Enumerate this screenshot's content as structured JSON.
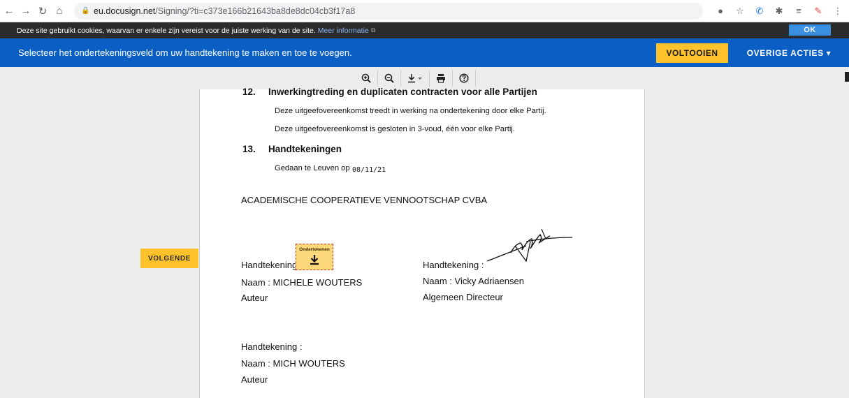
{
  "browser": {
    "url_domain": "eu.docusign.net",
    "url_path": "/Signing/?ti=c373e166b21643ba8de8dc04cb3f17a8"
  },
  "cookie_bar": {
    "text": "Deze site gebruikt cookies, waarvan er enkele zijn vereist voor de juiste werking van de site.",
    "link": "Meer informatie",
    "ok_label": "OK"
  },
  "action_bar": {
    "message": "Selecteer het ondertekeningsveld om uw handtekening te maken en toe te voegen.",
    "finish_label": "VOLTOOIEN",
    "other_label": "OVERIGE ACTIES ▾"
  },
  "toolbar": {
    "tools": [
      "zoom-in",
      "zoom-out",
      "download",
      "print",
      "help"
    ]
  },
  "navigation": {
    "next_label": "VOLGENDE"
  },
  "document": {
    "section12": {
      "number": "12.",
      "title": "Inwerkingtreding en duplicaten contracten voor alle Partijen",
      "para1": "Deze uitgeefovereenkomst treedt in werking na ondertekening door elke Partij.",
      "para2": "Deze uitgeefovereenkomst is gesloten in 3-voud, één voor elke Partij."
    },
    "section13": {
      "number": "13.",
      "title": "Handtekeningen",
      "done_at": "Gedaan te Leuven op",
      "date": "08/11/21"
    },
    "party": "ACADEMISCHE COOPERATIEVE VENNOOTSCHAP CVBA",
    "signer1": {
      "sig_label": "Handtekening :",
      "name": "Naam : MICHELE WOUTERS",
      "role": "Auteur"
    },
    "signer2": {
      "sig_label": "Handtekening :",
      "name": "Naam : Vicky Adriaensen",
      "role": "Algemeen Directeur"
    },
    "signer3": {
      "sig_label": "Handtekening :",
      "name": "Naam : MICH WOUTERS",
      "role": "Auteur"
    },
    "sign_tag_label": "Ondertekenen"
  },
  "colors": {
    "action_blue": "#0b5fc4",
    "accent_yellow": "#fec32c"
  }
}
